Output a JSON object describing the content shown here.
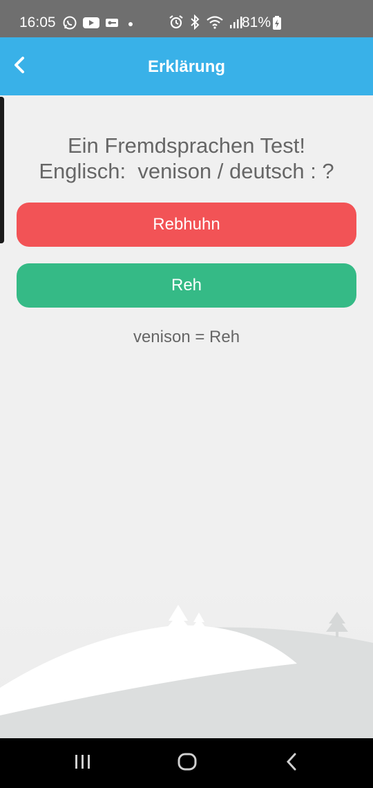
{
  "status_bar": {
    "time": "16:05",
    "battery_percent": "81%",
    "left_icons": [
      "whatsapp-icon",
      "youtube-icon",
      "vpn-key-icon",
      "dot-icon"
    ],
    "right_icons": [
      "alarm-icon",
      "bluetooth-icon",
      "wifi-icon",
      "signal-icon",
      "battery-charging-icon"
    ]
  },
  "app_bar": {
    "title": "Erklärung",
    "back_icon": "chevron-left-icon",
    "color": "#39b1e8"
  },
  "question": {
    "line1": "Ein Fremdsprachen Test!",
    "line2": "Englisch:  venison / deutsch : ?"
  },
  "answers": [
    {
      "label": "Rebhuhn",
      "state": "wrong",
      "color": "#f25356"
    },
    {
      "label": "Reh",
      "state": "correct",
      "color": "#35ba86"
    }
  ],
  "explanation": "venison = Reh",
  "nav_bar": {
    "buttons": [
      "recents-icon",
      "home-icon",
      "back-icon"
    ]
  }
}
